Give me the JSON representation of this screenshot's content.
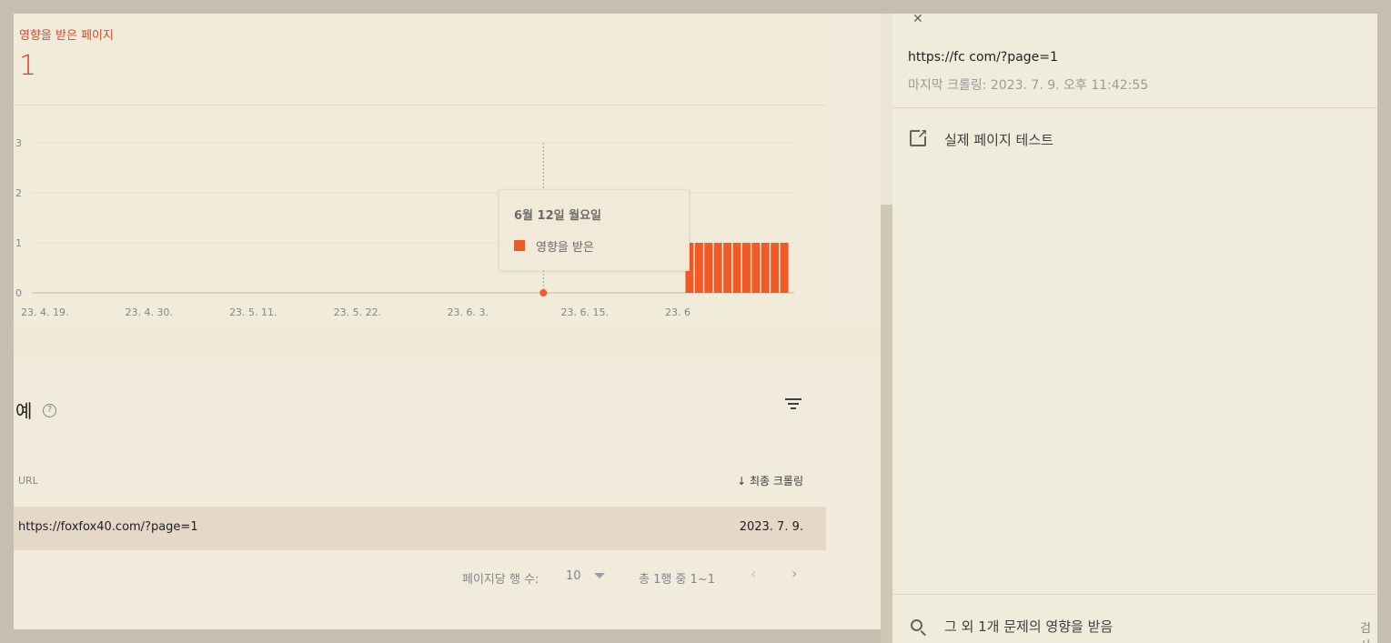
{
  "summary": {
    "label": "영향을 받은 페이지",
    "value": "1"
  },
  "chart_data": {
    "type": "bar",
    "title": "",
    "xlabel": "",
    "ylabel": "",
    "ylim": [
      0,
      3
    ],
    "yticks": [
      "0",
      "1",
      "2",
      "3"
    ],
    "xtick_labels": [
      "23. 4. 19.",
      "23. 4. 30.",
      "23. 5. 11.",
      "23. 5. 22.",
      "23. 6. 3.",
      "23. 6. 15.",
      "23. 6"
    ],
    "series": [
      {
        "name": "영향을 받은",
        "color": "#f25a25",
        "points": [
          {
            "x": "23. 6. 12.",
            "y": 0
          },
          {
            "x": "23. 6. 27.",
            "y": 1
          },
          {
            "x": "23. 6. 28.",
            "y": 1
          },
          {
            "x": "23. 6. 29.",
            "y": 1
          },
          {
            "x": "23. 6. 30.",
            "y": 1
          },
          {
            "x": "23. 7. 1.",
            "y": 1
          },
          {
            "x": "23. 7. 2.",
            "y": 1
          },
          {
            "x": "23. 7. 3.",
            "y": 1
          },
          {
            "x": "23. 7. 4.",
            "y": 1
          },
          {
            "x": "23. 7. 5.",
            "y": 1
          },
          {
            "x": "23. 7. 6.",
            "y": 1
          },
          {
            "x": "23. 7. 7.",
            "y": 1
          }
        ]
      }
    ],
    "tooltip": {
      "date": "6월 12일 월요일",
      "series_label": "영향을 받은"
    }
  },
  "examples": {
    "title": "예",
    "help": "?",
    "columns": {
      "url": "URL",
      "last_crawl": "최종 크롤링"
    },
    "sort_arrow": "↓",
    "rows": [
      {
        "url": "https://foxfox40.com/?page=1",
        "date": "2023. 7. 9."
      }
    ],
    "pager": {
      "rows_label": "페이지당 행 수:",
      "rows_value": "10",
      "range": "총 1행 중 1~1",
      "prev": "‹",
      "next": "›"
    }
  },
  "detail": {
    "url": "https://fc      com/?page=1",
    "last_crawl": "마지막 크롤링: 2023. 7. 9. 오후 11:42:55",
    "live_test": "실제 페이지 테스트",
    "other_issue": "그 외 1개 문제의 영향을 받음",
    "inspect": "검사"
  },
  "icons": {
    "pin": "pin-icon",
    "open": "open-in-new-icon",
    "search": "search-icon",
    "filter": "filter-icon",
    "help": "help-icon"
  }
}
